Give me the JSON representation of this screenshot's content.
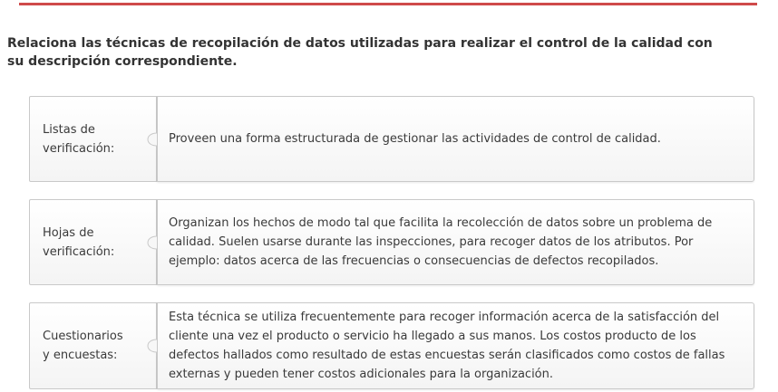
{
  "activity": {
    "instructions": "Relaciona las técnicas de recopilación de datos utilizadas para realizar el control de la calidad con su descripción correspondiente.",
    "pairs": [
      {
        "term": "Listas de verificación:",
        "description": "Proveen una forma estructurada de gestionar las actividades de control de calidad."
      },
      {
        "term": "Hojas de verificación:",
        "description": "Organizan los hechos de modo tal que facilita la recolección de datos sobre un problema de calidad. Suelen usarse durante las inspecciones, para recoger datos de los atributos. Por ejemplo: datos acerca de las frecuencias o consecuencias de defectos recopilados."
      },
      {
        "term": "Cuestionarios y encuestas:",
        "description": "Esta técnica se utiliza frecuentemente para recoger información acerca de la satisfacción del cliente una vez el producto o servicio ha llegado a sus manos. Los costos producto de los defectos hallados como resultado de estas encuestas serán clasificados como costos de fallas externas y pueden tener costos adicionales para la organización."
      }
    ]
  },
  "colors": {
    "accent_rule": "#cf4a4a",
    "border": "#c9c9c9",
    "text": "#3a3a3a"
  },
  "icons": {
    "connector": "puzzle-connector-icon"
  }
}
